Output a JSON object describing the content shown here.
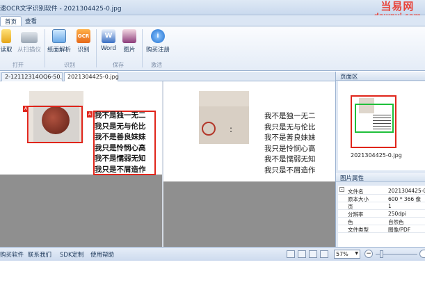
{
  "window": {
    "title": "速OCR文字识别软件 - 2021304425-0.jpg"
  },
  "watermark": {
    "line1": "当易网",
    "line2": "downyi.com"
  },
  "ribbon_tabs": [
    {
      "label": "首页"
    },
    {
      "label": "查看"
    }
  ],
  "ribbon": {
    "buttons": [
      {
        "label": "读取"
      },
      {
        "label": "从扫描仪"
      },
      {
        "label": "纸面解析"
      },
      {
        "label": "识别"
      },
      {
        "label": "Word"
      },
      {
        "label": "图片"
      },
      {
        "label": "购买注册"
      }
    ],
    "groups": [
      {
        "label": "打开"
      },
      {
        "label": "识别"
      },
      {
        "label": "保存"
      },
      {
        "label": "激活"
      }
    ]
  },
  "doc_tabs": [
    {
      "label": "2-12112314OQ6-50.j..."
    },
    {
      "label": "2021304425-0.jpg"
    }
  ],
  "poem": [
    "我不是独一无二",
    "我只是无与伦比",
    "我不是善良妹妹",
    "我只是怜悯心高",
    "我不是懦弱无知",
    "我只是不屑造作"
  ],
  "poem_right": [
    "我不是独一无二",
    "我只是无与伦比",
    "我不是善良妹妹",
    "我只是怜悯心高",
    "我不是懦弱无知",
    "我只是不屑造作"
  ],
  "region_badge": "A",
  "sidebar": {
    "page_area_title": "页面区",
    "thumb_caption": "2021304425-0.jpg",
    "props_title": "图片属性",
    "props": [
      {
        "key": "文件名",
        "value": "2021304425-0"
      },
      {
        "key": "原本大小",
        "value": "600 * 366 像"
      },
      {
        "key": "页",
        "value": "1"
      },
      {
        "key": "分辨率",
        "value": "250dpi"
      },
      {
        "key": "色",
        "value": "自然色"
      },
      {
        "key": "文件类型",
        "value": "图像/PDF"
      }
    ]
  },
  "status": {
    "links": [
      {
        "label": "购买软件"
      },
      {
        "label": "联系我们"
      },
      {
        "label": "SDK定制"
      },
      {
        "label": "使用帮助"
      }
    ],
    "zoom": "57%"
  }
}
